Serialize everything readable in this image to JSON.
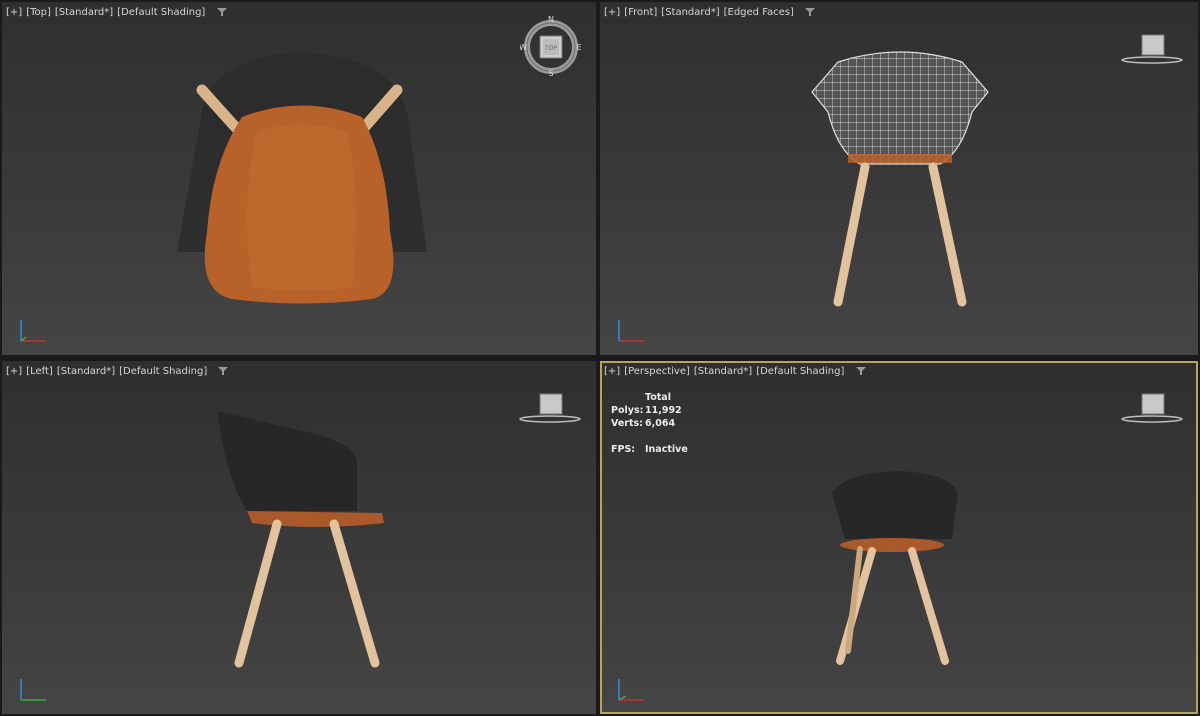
{
  "viewports": {
    "top": {
      "plus": "[+]",
      "view": "[Top]",
      "preset": "[Standard*]",
      "shading": "[Default Shading]"
    },
    "front": {
      "plus": "[+]",
      "view": "[Front]",
      "preset": "[Standard*]",
      "shading": "[Edged Faces]"
    },
    "left": {
      "plus": "[+]",
      "view": "[Left]",
      "preset": "[Standard*]",
      "shading": "[Default Shading]"
    },
    "perspective": {
      "plus": "[+]",
      "view": "[Perspective]",
      "preset": "[Standard*]",
      "shading": "[Default Shading]"
    }
  },
  "compass": {
    "n": "N",
    "s": "S",
    "e": "E",
    "w": "W",
    "cube_face": "TOP"
  },
  "stats": {
    "header": "Total",
    "polys_label": "Polys:",
    "polys_value": "11,992",
    "verts_label": "Verts:",
    "verts_value": "6,064",
    "fps_label": "FPS:",
    "fps_value": "Inactive"
  },
  "colors": {
    "active_border": "#b7a55f",
    "wood_seat": "#b8622a",
    "leg_wood": "#e3c29e",
    "wire": "#d8d8d8"
  }
}
